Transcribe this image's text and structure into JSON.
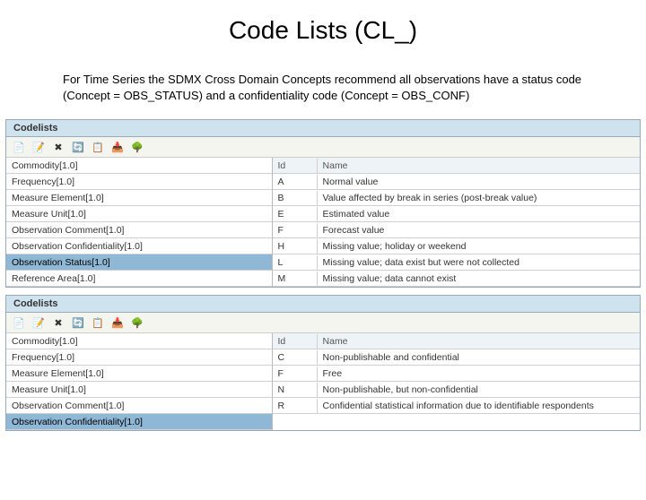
{
  "title": "Code Lists (CL_)",
  "body": "For Time Series the SDMX Cross Domain Concepts recommend all observations have a status code (Concept = OBS_STATUS) and a confidentiality code (Concept = OBS_CONF)",
  "panel_label": "Codelists",
  "toolbar_icons": [
    {
      "name": "new-icon",
      "glyph": "📄"
    },
    {
      "name": "edit-icon",
      "glyph": "📝"
    },
    {
      "name": "delete-icon",
      "glyph": "✖"
    },
    {
      "name": "refresh-icon",
      "glyph": "🔄"
    },
    {
      "name": "copy-icon",
      "glyph": "📋"
    },
    {
      "name": "paste-icon",
      "glyph": "📥"
    },
    {
      "name": "tree-icon",
      "glyph": "🌳"
    }
  ],
  "panel1": {
    "left_items": [
      "Commodity[1.0]",
      "Frequency[1.0]",
      "Measure Element[1.0]",
      "Measure Unit[1.0]",
      "Observation Comment[1.0]",
      "Observation Confidentiality[1.0]",
      "Observation Status[1.0]",
      "Reference Area[1.0]"
    ],
    "selected_index": 6,
    "right_header": {
      "id": "Id",
      "name": "Name"
    },
    "right_rows": [
      {
        "id": "A",
        "name": "Normal value"
      },
      {
        "id": "B",
        "name": "Value affected by break in series (post-break value)"
      },
      {
        "id": "E",
        "name": "Estimated value"
      },
      {
        "id": "F",
        "name": "Forecast value"
      },
      {
        "id": "H",
        "name": "Missing value; holiday or weekend"
      },
      {
        "id": "L",
        "name": "Missing value; data exist but were not collected"
      },
      {
        "id": "M",
        "name": "Missing value; data cannot exist"
      }
    ]
  },
  "panel2": {
    "left_items": [
      "Commodity[1.0]",
      "Frequency[1.0]",
      "Measure Element[1.0]",
      "Measure Unit[1.0]",
      "Observation Comment[1.0]",
      "Observation Confidentiality[1.0]"
    ],
    "selected_index": 5,
    "right_header": {
      "id": "Id",
      "name": "Name"
    },
    "right_rows": [
      {
        "id": "C",
        "name": "Non-publishable and confidential"
      },
      {
        "id": "F",
        "name": "Free"
      },
      {
        "id": "N",
        "name": "Non-publishable, but non-confidential"
      },
      {
        "id": "R",
        "name": "Confidential statistical information due to identifiable respondents"
      }
    ]
  }
}
